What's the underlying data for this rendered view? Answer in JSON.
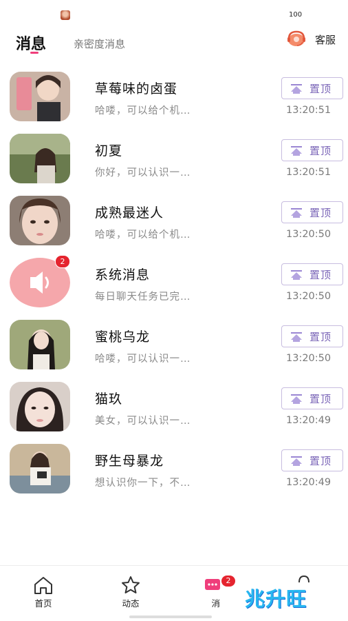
{
  "status_bar": {
    "battery": "100"
  },
  "header": {
    "active_tab": "消息",
    "inactive_tab": "亲密度消息",
    "service_label": "客服"
  },
  "colors": {
    "accent_pink": "#ef3e7b",
    "pin_purple": "#7b66b8",
    "badge_red": "#e5242f"
  },
  "messages": [
    {
      "name": "草莓味的卤蛋",
      "preview": "哈喽，可以给个机…",
      "pin_label": "置顶",
      "time": "13:20:51",
      "avatar": "photo"
    },
    {
      "name": "初夏",
      "preview": "你好，可以认识一…",
      "pin_label": "置顶",
      "time": "13:20:51",
      "avatar": "photo"
    },
    {
      "name": "成熟最迷人",
      "preview": "哈喽，可以给个机…",
      "pin_label": "置顶",
      "time": "13:20:50",
      "avatar": "photo"
    },
    {
      "name": "系统消息",
      "preview": "每日聊天任务已完…",
      "pin_label": "置顶",
      "time": "13:20:50",
      "avatar": "speaker-icon",
      "badge": "2"
    },
    {
      "name": "蜜桃乌龙",
      "preview": "哈喽，可以认识一…",
      "pin_label": "置顶",
      "time": "13:20:50",
      "avatar": "photo"
    },
    {
      "name": "猫玖",
      "preview": "美女，可以认识一…",
      "pin_label": "置顶",
      "time": "13:20:49",
      "avatar": "photo"
    },
    {
      "name": "野生母暴龙",
      "preview": "想认识你一下，不…",
      "pin_label": "置顶",
      "time": "13:20:49",
      "avatar": "photo"
    }
  ],
  "tab_bar": {
    "home_label": "首页",
    "moments_label": "动态",
    "messages_label": "消",
    "messages_badge": "2"
  },
  "watermark": "兆升旺"
}
